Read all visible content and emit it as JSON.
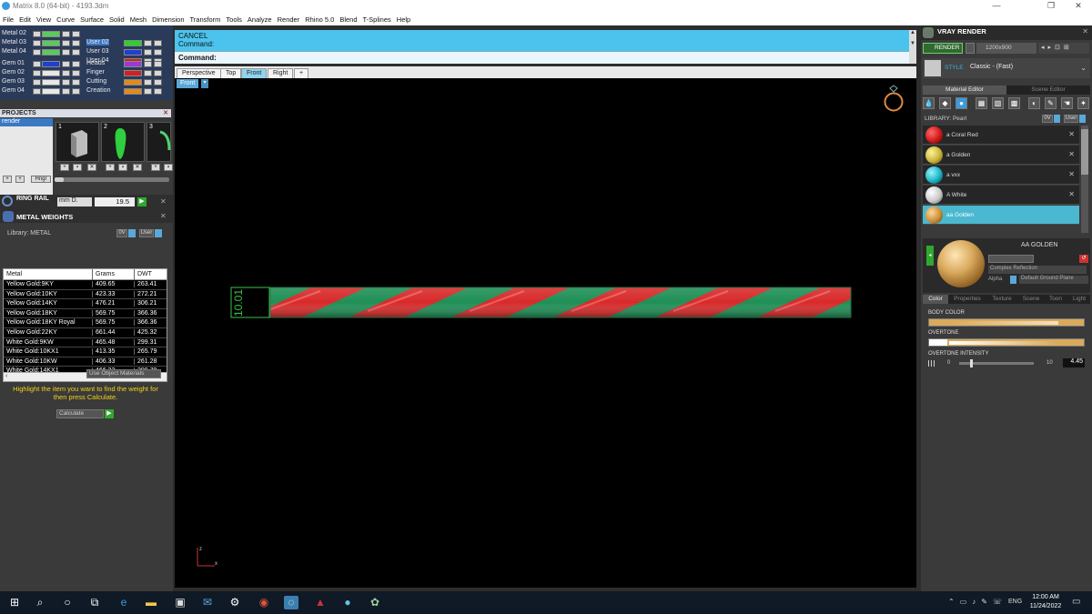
{
  "titlebar": {
    "title": "Matrix 8.0 (64-bit) - 4193.3dm",
    "minimize": "—",
    "maximize": "❐",
    "close": "✕"
  },
  "menu": [
    "File",
    "Edit",
    "View",
    "Curve",
    "Surface",
    "Solid",
    "Mesh",
    "Dimension",
    "Transform",
    "Tools",
    "Analyze",
    "Render",
    "Rhino 5.0",
    "Blend",
    "T-Splines",
    "Help"
  ],
  "layers": {
    "left": [
      {
        "name": "Metal 02",
        "color": "#5acb5a"
      },
      {
        "name": "Metal 03",
        "color": "#5acb5a"
      },
      {
        "name": "Metal 04",
        "color": "#5acb5a"
      },
      {
        "name": "Gem 01",
        "color": "#1e3fd0"
      },
      {
        "name": "Gem 02",
        "color": "#e8e8e8"
      },
      {
        "name": "Gem 03",
        "color": "#e8e8e8"
      },
      {
        "name": "Gem 04",
        "color": "#e8e8e8"
      }
    ],
    "right": [
      {
        "name": "User 02",
        "color": "#28d428",
        "selected": true
      },
      {
        "name": "User 03",
        "color": "#1e3fd0"
      },
      {
        "name": "User 04",
        "color": "#d02020"
      },
      {
        "name": "Heads",
        "color": "#9a3ad0"
      },
      {
        "name": "Finger",
        "color": "#d02020"
      },
      {
        "name": "Cutting",
        "color": "#e08a20"
      },
      {
        "name": "Creation",
        "color": "#e08a20"
      }
    ]
  },
  "projects": {
    "title": "PROJECTS",
    "item": "render",
    "thumbs": [
      "1",
      "2",
      "3"
    ],
    "hinge_btn": "Hngr"
  },
  "ring_rail": {
    "label": "RING RAIL",
    "unit": "mm D.",
    "value": "19.5"
  },
  "metal_weights": {
    "title": "METAL WEIGHTS",
    "library_label": "Library: METAL",
    "lib_btn1": "0V",
    "lib_btn2": "User",
    "columns": [
      "Metal",
      "Grams",
      "DWT"
    ],
    "rows": [
      [
        "Yellow Gold:9KY",
        "409.65",
        "263.41"
      ],
      [
        "Yellow Gold:10KY",
        "423.33",
        "272.21"
      ],
      [
        "Yellow Gold:14KY",
        "476.21",
        "306.21"
      ],
      [
        "Yellow Gold:18KY",
        "569.75",
        "366.36"
      ],
      [
        "Yellow Gold:18KY Royal",
        "569.75",
        "366.36"
      ],
      [
        "Yellow Gold:22KY",
        "661.44",
        "425.32"
      ],
      [
        "White Gold:9KW",
        "465.48",
        "299.31"
      ],
      [
        "White Gold:10KX1",
        "413.35",
        "265.79"
      ],
      [
        "White Gold:10KW",
        "406.33",
        "261.28"
      ],
      [
        "White Gold:14KX1",
        "466.22",
        "299.79"
      ]
    ],
    "use_object_materials": "Use Object Materials",
    "hint": "Highlight the item you want to find the weight for then press Calculate.",
    "calculate": "Calculate"
  },
  "command": {
    "line1": "CANCEL",
    "line2": "Command:",
    "prompt": "Command:"
  },
  "view_tabs": [
    "Perspective",
    "Top",
    "Front",
    "Right",
    "+"
  ],
  "active_view": "Front",
  "viewport": {
    "label": "Front",
    "dimension": "10.01",
    "axis_z": "z",
    "axis_x": "x"
  },
  "vray": {
    "title": "VRAY RENDER",
    "render_btn": "RENDER",
    "resolution": "1200x900",
    "style_label": "STYLE",
    "style_value": "Classic - (Fast)",
    "tabs": [
      "Material Editor",
      "Scene Editor"
    ],
    "library_label": "LIBRARY: Pearl",
    "lib_btn1": "0V",
    "lib_btn2": "User",
    "materials": [
      {
        "name": "a Coral Red",
        "color": "#cc1a1a"
      },
      {
        "name": "a Golden",
        "color": "#c9b53a"
      },
      {
        "name": "a vxx",
        "color": "#1bb3c4"
      },
      {
        "name": "A White",
        "color": "#d9d9d9"
      },
      {
        "name": "aa Golden",
        "color": "#c9903a",
        "selected": true
      }
    ],
    "selected_name": "AA  GOLDEN",
    "preset": "Complex Reflection",
    "alpha_label": "Alpha",
    "ground": "Default Ground Plane",
    "prop_tabs": [
      "Color",
      "Properties",
      "Texture",
      "Scene",
      "Toon",
      "Light"
    ],
    "body_color_label": "BODY COLOR",
    "overtone_label": "OVERTONE",
    "overtone_intensity_label": "OVERTONE INTENSITY",
    "intensity_min": "0",
    "intensity_max": "10",
    "intensity_value": "4.45",
    "body_color": "#d9a95c"
  },
  "taskbar": {
    "lang": "ENG",
    "time": "12:00 AM",
    "date": "11/24/2022"
  }
}
